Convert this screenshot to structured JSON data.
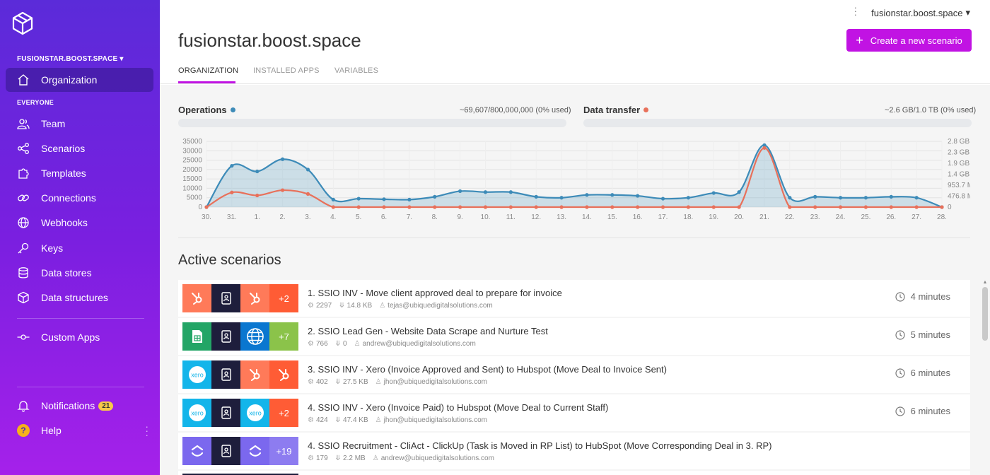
{
  "sidebar": {
    "org_name": "FUSIONSTAR.BOOST.SPACE",
    "org_caret": "▾",
    "active_item": "Organization",
    "section_label": "EVERYONE",
    "items": [
      {
        "label": "Team",
        "icon": "team-icon"
      },
      {
        "label": "Scenarios",
        "icon": "share-icon"
      },
      {
        "label": "Templates",
        "icon": "puzzle-icon"
      },
      {
        "label": "Connections",
        "icon": "link-icon"
      },
      {
        "label": "Webhooks",
        "icon": "globe-icon"
      },
      {
        "label": "Keys",
        "icon": "key-icon"
      },
      {
        "label": "Data stores",
        "icon": "database-icon"
      },
      {
        "label": "Data structures",
        "icon": "cube-icon"
      }
    ],
    "custom_apps": "Custom Apps",
    "notifications": "Notifications",
    "notifications_count": "21",
    "help": "Help",
    "help_glyph": "?"
  },
  "header": {
    "account": "fusionstar.boost.space",
    "account_caret": "▾",
    "title": "fusionstar.boost.space",
    "create_button": "Create a new scenario",
    "create_plus": "+",
    "tabs": [
      "ORGANIZATION",
      "INSTALLED APPS",
      "VARIABLES"
    ]
  },
  "usage": {
    "operations_label": "Operations",
    "operations_value": "~69,607/800,000,000 (0% used)",
    "transfer_label": "Data transfer",
    "transfer_value": "~2.6 GB/1.0 TB (0% used)",
    "operations_color": "#3d8bb8",
    "transfer_color": "#e8705a"
  },
  "chart_data": {
    "type": "line",
    "x": [
      "30.",
      "31.",
      "1.",
      "2.",
      "3.",
      "4.",
      "5.",
      "6.",
      "7.",
      "8.",
      "9.",
      "10.",
      "11.",
      "12.",
      "13.",
      "14.",
      "15.",
      "16.",
      "17.",
      "18.",
      "19.",
      "20.",
      "21.",
      "22.",
      "23.",
      "24.",
      "25.",
      "26.",
      "27.",
      "28."
    ],
    "y_left_ticks": [
      "35000",
      "30000",
      "25000",
      "20000",
      "15000",
      "10000",
      "5000",
      "0"
    ],
    "y_right_ticks": [
      "2.8 GB",
      "2.3 GB",
      "1.9 GB",
      "1.4 GB",
      "953.7 MB",
      "476.8 MB",
      "0"
    ],
    "ylim": [
      0,
      35000
    ],
    "series": [
      {
        "name": "Operations",
        "color": "#3d8bb8",
        "values": [
          0,
          22000,
          19000,
          25500,
          20000,
          4000,
          4500,
          4200,
          4000,
          5500,
          8500,
          8000,
          8000,
          5500,
          5000,
          6500,
          6500,
          6000,
          4500,
          5000,
          7500,
          8000,
          33000,
          5000,
          5500,
          5000,
          5000,
          5500,
          5000,
          0
        ]
      },
      {
        "name": "Data transfer",
        "color": "#e8705a",
        "values": [
          0,
          7800,
          6200,
          9000,
          7000,
          0,
          0,
          0,
          0,
          0,
          0,
          0,
          0,
          0,
          0,
          0,
          0,
          0,
          0,
          0,
          0,
          0,
          31500,
          0,
          0,
          0,
          0,
          0,
          0,
          0
        ]
      }
    ]
  },
  "active_title": "Active scenarios",
  "scenarios": [
    {
      "name": "1. SSIO INV - Move client approved deal to prepare for invoice",
      "ops": "2297",
      "data": "14.8 KB",
      "user": "tejas@ubiquedigitalsolutions.com",
      "time": "4 minutes",
      "more": "+2"
    },
    {
      "name": "2. SSIO Lead Gen -  Website Data Scrape and Nurture Test",
      "ops": "766",
      "data": "0",
      "user": "andrew@ubiquedigitalsolutions.com",
      "time": "5 minutes",
      "more": "+7"
    },
    {
      "name": "3. SSIO INV - Xero (Invoice Approved and Sent) to Hubspot (Move Deal to Invoice Sent)",
      "ops": "402",
      "data": "27.5 KB",
      "user": "jhon@ubiquedigitalsolutions.com",
      "time": "6 minutes",
      "more": ""
    },
    {
      "name": "4. SSIO INV - Xero (Invoice Paid) to Hubspot (Move Deal to Current Staff)",
      "ops": "424",
      "data": "47.4 KB",
      "user": "jhon@ubiquedigitalsolutions.com",
      "time": "6 minutes",
      "more": "+2"
    },
    {
      "name": "4. SSIO Recruitment - CliAct - ClickUp (Task is Moved in RP List) to HubSpot (Move Corresponding Deal in 3. RP)",
      "ops": "179",
      "data": "2.2 MB",
      "user": "andrew@ubiquedigitalsolutions.com",
      "time": "",
      "more": "+19"
    }
  ],
  "tile_labels": {
    "xero": "xero"
  },
  "colors": {
    "accent": "#c113e3",
    "hubspot": "#ff7a59",
    "dark": "#1e1e3c",
    "sheets": "#23a566",
    "web": "#0a77d0",
    "lime": "#8bc34a",
    "clickup": "#7b68ee",
    "xero": "#13b5ea"
  }
}
